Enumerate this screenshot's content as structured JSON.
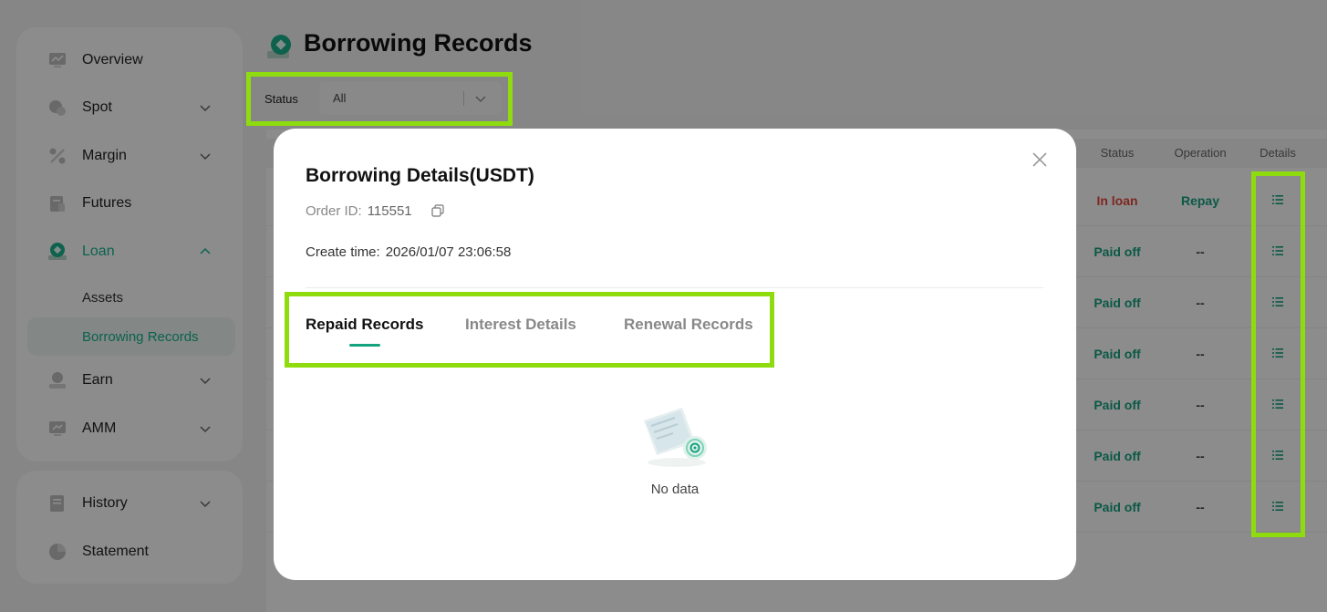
{
  "sidebar": {
    "items": [
      {
        "label": "Overview"
      },
      {
        "label": "Spot"
      },
      {
        "label": "Margin"
      },
      {
        "label": "Futures"
      },
      {
        "label": "Loan"
      },
      {
        "label": "Earn"
      },
      {
        "label": "AMM"
      }
    ],
    "loan_sub": [
      {
        "label": "Assets"
      },
      {
        "label": "Borrowing Records"
      }
    ],
    "bottom_items": [
      {
        "label": "History"
      },
      {
        "label": "Statement"
      }
    ]
  },
  "header": {
    "title": "Borrowing Records"
  },
  "filter": {
    "label": "Status",
    "value": "All"
  },
  "table": {
    "columns": [
      "Status",
      "Operation",
      "Details"
    ],
    "rows": [
      {
        "status": "In loan",
        "operation": "Repay"
      },
      {
        "status": "Paid off",
        "operation": "--"
      },
      {
        "status": "Paid off",
        "operation": "--"
      },
      {
        "status": "Paid off",
        "operation": "--"
      },
      {
        "status": "Paid off",
        "operation": "--"
      },
      {
        "status": "Paid off",
        "operation": "--"
      },
      {
        "status": "Paid off",
        "operation": "--"
      }
    ]
  },
  "modal": {
    "title": "Borrowing Details(USDT)",
    "order_label": "Order ID:",
    "order_id": "115551",
    "create_label": "Create time:",
    "create_time": "2026/01/07 23:06:58",
    "tabs": [
      "Repaid Records",
      "Interest Details",
      "Renewal Records"
    ],
    "empty_text": "No data"
  },
  "colors": {
    "accent": "#14a37f",
    "in_loan": "#e5483d",
    "highlight": "#8fdc0e"
  }
}
